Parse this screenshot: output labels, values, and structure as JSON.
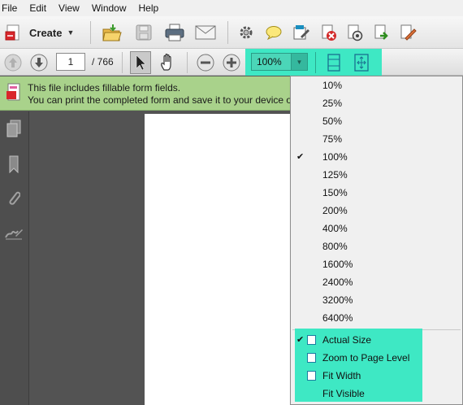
{
  "menubar": {
    "items": [
      "File",
      "Edit",
      "View",
      "Window",
      "Help"
    ]
  },
  "toolbar": {
    "create_label": "Create",
    "tools": [
      "open-folder-icon",
      "save-icon",
      "print-icon",
      "email-icon",
      "gear-icon",
      "comment-icon",
      "form-edit-icon",
      "remove-icon",
      "settings-icon",
      "share-icon",
      "sign-icon"
    ]
  },
  "navigation": {
    "current_page": "1",
    "page_count": "/ 766"
  },
  "zoom": {
    "value": "100%"
  },
  "notice": {
    "line1": "This file includes fillable form fields.",
    "line2": "You can print the completed form and save it to your device o"
  },
  "zoom_menu": {
    "options": [
      "10%",
      "25%",
      "50%",
      "75%",
      "100%",
      "125%",
      "150%",
      "200%",
      "400%",
      "800%",
      "1600%",
      "2400%",
      "3200%",
      "6400%"
    ],
    "selected": "100%",
    "view_options": [
      "Actual Size",
      "Zoom to Page Level",
      "Fit Width",
      "Fit Visible"
    ],
    "view_selected": "Actual Size"
  },
  "left_panel": {
    "icons": [
      "pages-icon",
      "bookmark-icon",
      "attachment-icon",
      "signature-icon"
    ]
  },
  "colors": {
    "highlight": "#3ee8c4",
    "notice_bg": "#a9d28b"
  }
}
